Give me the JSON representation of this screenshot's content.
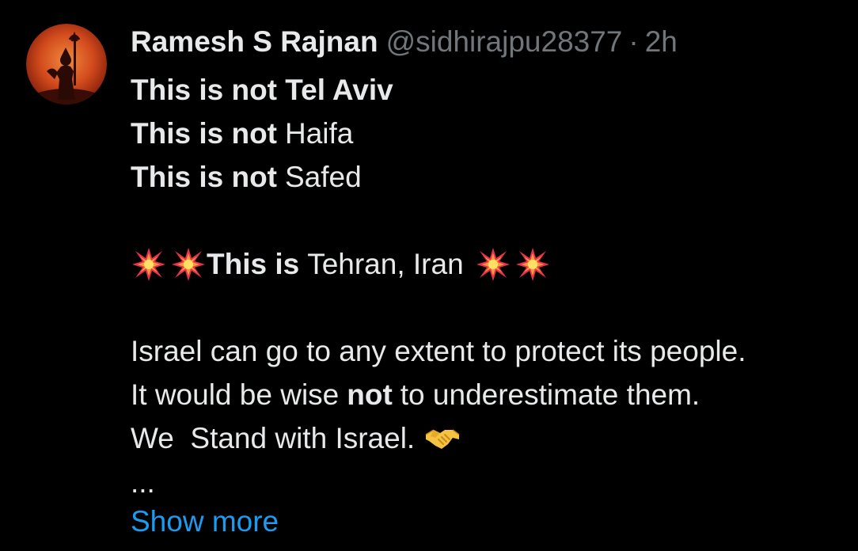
{
  "tweet": {
    "author": {
      "display_name": "Ramesh S Rajnan",
      "handle": "@sidhirajpu28377",
      "avatar_icon": "avatar-silhouette-orange"
    },
    "separator": "·",
    "timestamp": "2h",
    "lines": {
      "l1_bold": "This is not Tel Aviv",
      "l2_bold": "This is not",
      "l2_rest": "Haifa",
      "l3_bold": "This is not",
      "l3_rest": "Safed",
      "l4_bold": "This is",
      "l4_rest": "Tehran, Iran",
      "l5": "Israel can go to any extent to protect its people.",
      "l6_pre": "It would be wise",
      "l6_bold": "not",
      "l6_post": "to underestimate them.",
      "l7": "We  Stand with Israel."
    },
    "emoji": {
      "collision": "collision-emoji",
      "handshake": "handshake-emoji"
    },
    "ellipsis": "...",
    "show_more": "Show more",
    "colors": {
      "background": "#000000",
      "text": "#e7e9ea",
      "muted": "#71767b",
      "link": "#1d9bf0"
    }
  }
}
